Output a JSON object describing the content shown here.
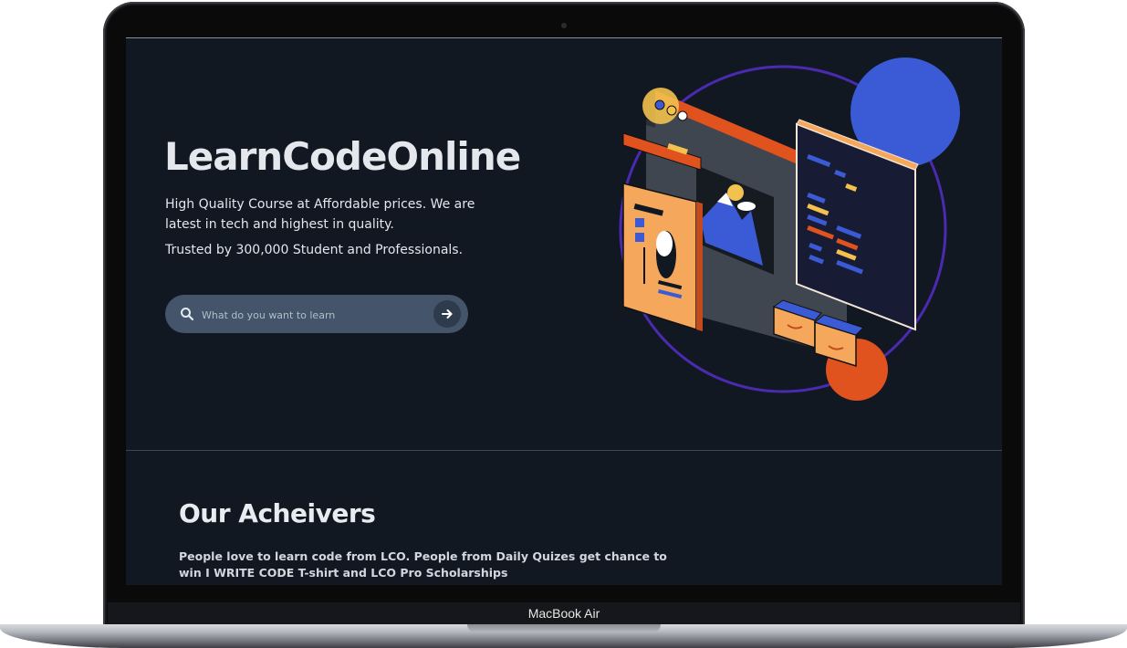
{
  "device": {
    "label": "MacBook Air"
  },
  "hero": {
    "title": "LearnCodeOnline",
    "description": "High Quality Course at Affordable prices. We are latest in tech and highest in quality.",
    "trust": "Trusted by 300,000 Student and Professionals.",
    "search": {
      "placeholder": "What do you want to learn"
    }
  },
  "achievers": {
    "title": "Our Acheivers",
    "description": "People love to learn code from LCO. People from Daily Quizes get chance to win I WRITE CODE T-shirt and LCO Pro Scholarships"
  },
  "icons": [
    "search-icon",
    "arrow-right-icon"
  ],
  "colors": {
    "page_bg": "#111822",
    "search_bg": "#44546a",
    "accent_blue": "#3b5bd6",
    "accent_orange": "#e0521e",
    "accent_purple": "#4a2bb0"
  }
}
